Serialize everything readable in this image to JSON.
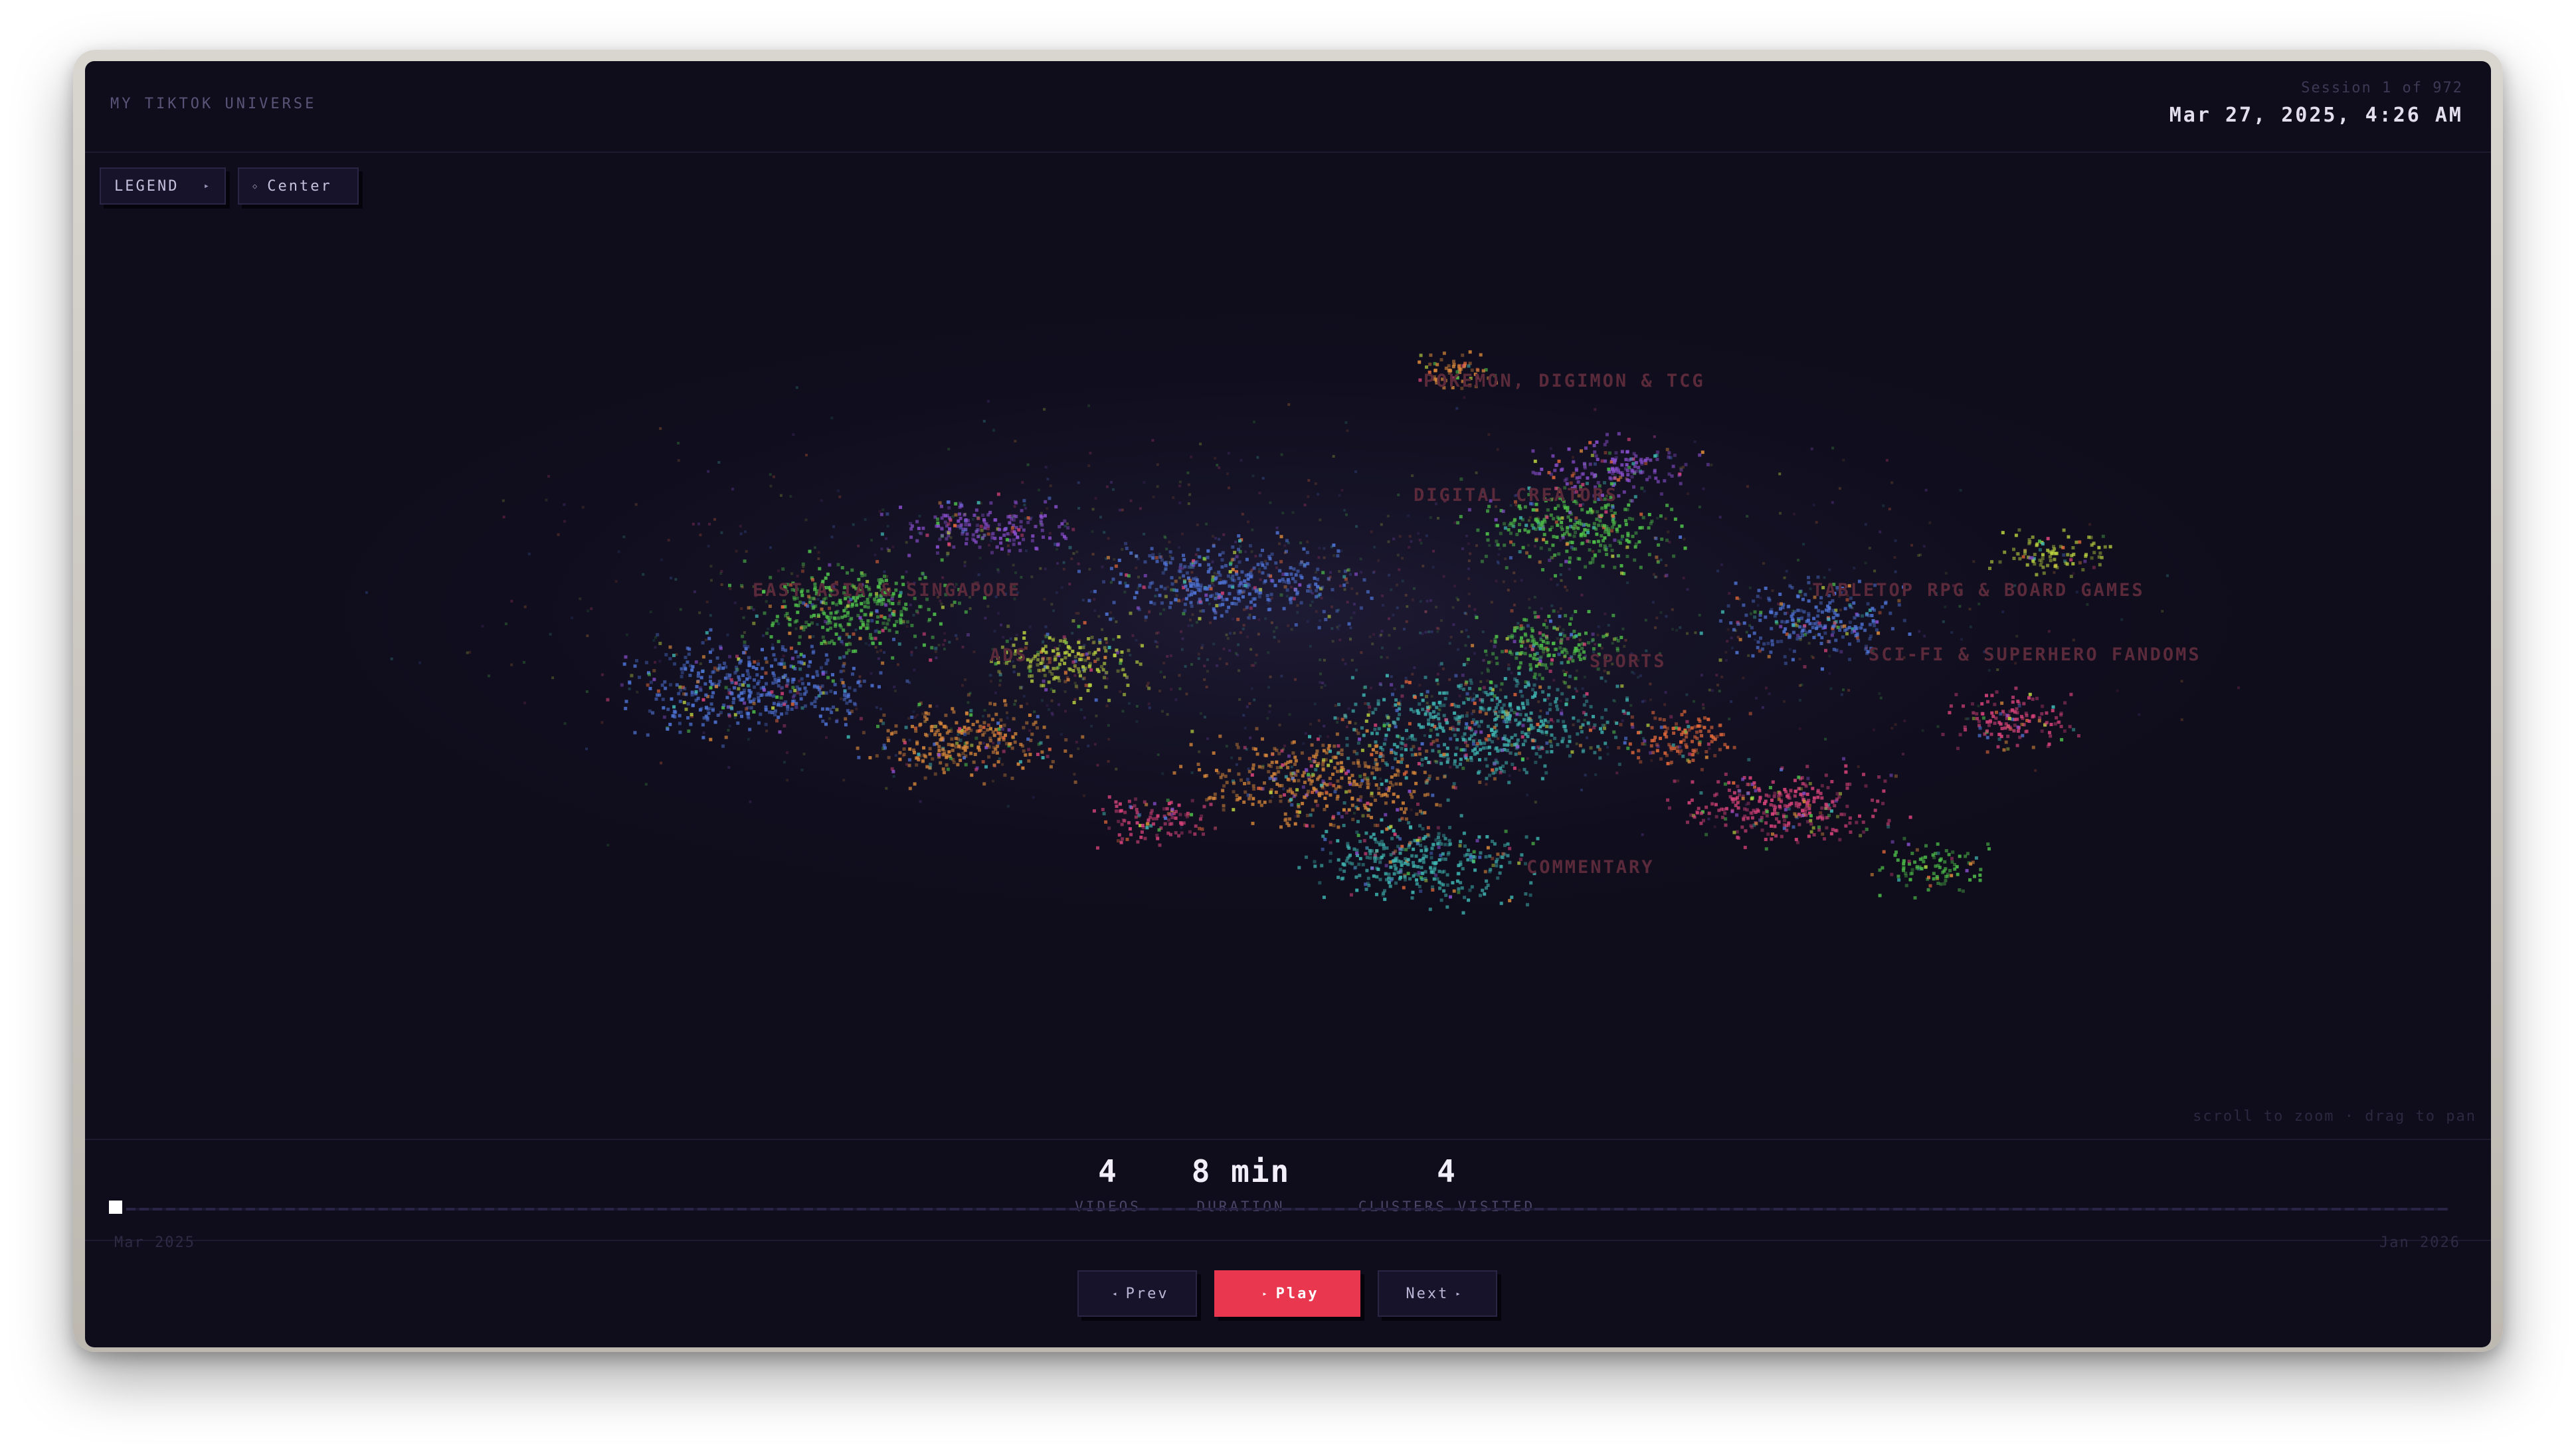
{
  "header": {
    "app_title": "MY TIKTOK UNIVERSE",
    "session_label": "Session 1 of 972",
    "date": "Mar 27, 2025, 4:26 AM"
  },
  "toolbar": {
    "legend_label": "LEGEND",
    "legend_icon": "triangle-right-icon",
    "center_label": "Center",
    "center_icon": "target-icon"
  },
  "map": {
    "hint": "scroll to zoom · drag to pan",
    "cluster_labels": [
      "POKEMON, DIGIMON & TCG",
      "DIGITAL CREATORS",
      "EAST ASIA & SINGAPORE",
      "ADS",
      "TABLETOP RPG & BOARD GAMES",
      "SCI-FI & SUPERHERO FANDOMS",
      "SPORTS",
      "COMMENTARY"
    ],
    "cluster_colors": [
      "#4fc24a",
      "#d9883a",
      "#8a4fcf",
      "#3fb6b2",
      "#d8437a",
      "#4f74d6",
      "#b7cf3f",
      "#e86a3a"
    ]
  },
  "stats": {
    "videos_value": "4",
    "videos_label": "VIDEOS",
    "duration_value": "8 min",
    "duration_label": "DURATION",
    "clusters_value": "4",
    "clusters_label": "CLUSTERS VISITED"
  },
  "timeline": {
    "start_label": "Mar 2025",
    "end_label": "Jan 2026",
    "progress": 0.0
  },
  "controls": {
    "prev_label": "Prev",
    "play_label": "Play",
    "next_label": "Next"
  }
}
